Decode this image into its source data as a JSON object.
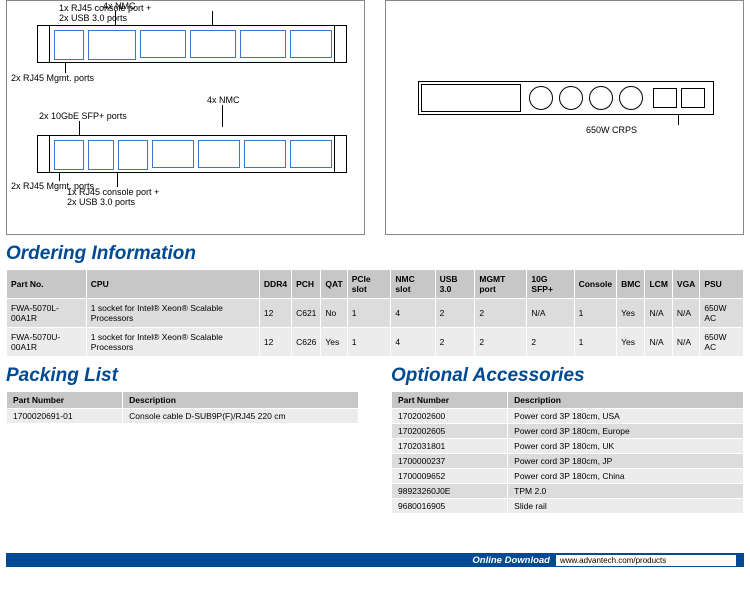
{
  "diagrams": {
    "left": {
      "label_nmc_top": "4x NMC",
      "label_console_top": "1x RJ45 console port +\n2x USB 3.0 ports",
      "label_mgmt_top": "2x RJ45 Mgmt. ports",
      "label_nmc_bottom": "4x NMC",
      "label_sfp": "2x 10GbE SFP+ ports",
      "label_mgmt_bottom": "2x RJ45 Mgmt. ports",
      "label_console_bottom": "1x RJ45 console port +\n2x USB 3.0 ports"
    },
    "right": {
      "label_crps": "650W CRPS"
    }
  },
  "ordering": {
    "title": "Ordering Information",
    "headers": [
      "Part No.",
      "CPU",
      "DDR4",
      "PCH",
      "QAT",
      "PCIe slot",
      "NMC slot",
      "USB 3.0",
      "MGMT port",
      "10G SFP+",
      "Console",
      "BMC",
      "LCM",
      "VGA",
      "PSU"
    ],
    "rows": [
      [
        "FWA-5070L-00A1R",
        "1 socket for Intel® Xeon® Scalable Processors",
        "12",
        "C621",
        "No",
        "1",
        "4",
        "2",
        "2",
        "N/A",
        "1",
        "Yes",
        "N/A",
        "N/A",
        "650W AC"
      ],
      [
        "FWA-5070U-00A1R",
        "1 socket for Intel® Xeon® Scalable Processors",
        "12",
        "C626",
        "Yes",
        "1",
        "4",
        "2",
        "2",
        "2",
        "1",
        "Yes",
        "N/A",
        "N/A",
        "650W AC"
      ]
    ]
  },
  "packing": {
    "title": "Packing List",
    "headers": [
      "Part Number",
      "Description"
    ],
    "rows": [
      [
        "1700020691-01",
        "Console cable D-SUB9P(F)/RJ45 220 cm"
      ]
    ]
  },
  "accessories": {
    "title": "Optional Accessories",
    "headers": [
      "Part Number",
      "Description"
    ],
    "rows": [
      [
        "1702002600",
        "Power cord 3P 180cm, USA"
      ],
      [
        "1702002605",
        "Power cord 3P 180cm, Europe"
      ],
      [
        "1702031801",
        "Power cord 3P 180cm, UK"
      ],
      [
        "1700000237",
        "Power cord 3P 180cm, JP"
      ],
      [
        "1700009652",
        "Power cord 3P 180cm, China"
      ],
      [
        "98923260J0E",
        "TPM 2.0"
      ],
      [
        "9680016905",
        "Slide rail"
      ]
    ]
  },
  "download": {
    "label": "Online Download",
    "url": "www.advantech.com/products"
  }
}
